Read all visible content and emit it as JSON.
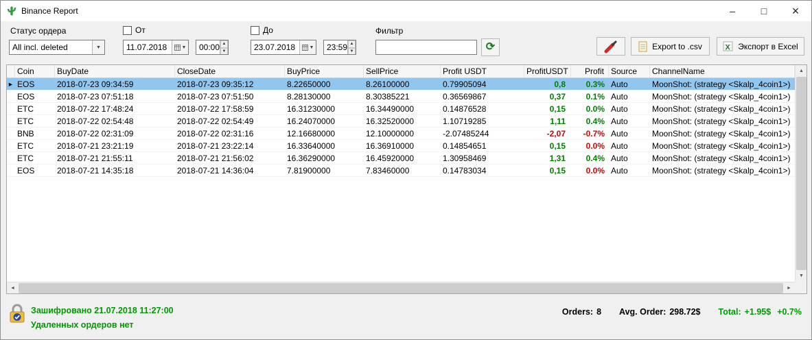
{
  "window": {
    "title": "Binance Report"
  },
  "icons": {
    "minimize": "–",
    "maximize": "□",
    "close": "×",
    "down_arrow": "▼",
    "up_arrow": "▲",
    "left_arrow": "◄",
    "right_arrow": "►",
    "row_pointer": "►",
    "refresh": "⟳"
  },
  "colors": {
    "selection": "#93c6ef",
    "positive": "#007e00",
    "negative": "#d40000",
    "status_green": "#009900"
  },
  "toolbar": {
    "status_label": "Статус ордера",
    "status_value": "All incl. deleted",
    "from_label": "От",
    "from_date": "11.07.2018",
    "from_time": "00:00",
    "to_label": "До",
    "to_date": "23.07.2018",
    "to_time": "23:59",
    "filter_label": "Фильтр",
    "filter_value": "",
    "export_csv_label": "Export to .csv",
    "export_excel_label": "Экспорт в Excel"
  },
  "grid": {
    "columns": [
      {
        "key": "coin",
        "label": "Coin"
      },
      {
        "key": "buydate",
        "label": "BuyDate"
      },
      {
        "key": "closedate",
        "label": "CloseDate"
      },
      {
        "key": "buyprice",
        "label": "BuyPrice"
      },
      {
        "key": "sellprice",
        "label": "SellPrice"
      },
      {
        "key": "profitusdtfull",
        "label": "Profit USDT"
      },
      {
        "key": "profitusdt",
        "label": "ProfitUSDT"
      },
      {
        "key": "profitpct",
        "label": "Profit"
      },
      {
        "key": "source",
        "label": "Source"
      },
      {
        "key": "channel",
        "label": "ChannelName"
      }
    ],
    "rows": [
      {
        "coin": "EOS",
        "buydate": "2018-07-23 09:34:59",
        "closedate": "2018-07-23 09:35:12",
        "buyprice": "8.22650000",
        "sellprice": "8.26100000",
        "profitusdtfull": "0.79905094",
        "profitusdt": "0,8",
        "profitpct": "0.3%",
        "source": "Auto",
        "channel": "MoonShot: (strategy <Skalp_4coin1>)",
        "usdt_color": "pos",
        "pct_color": "pos",
        "selected": true
      },
      {
        "coin": "EOS",
        "buydate": "2018-07-23 07:51:18",
        "closedate": "2018-07-23 07:51:50",
        "buyprice": "8.28130000",
        "sellprice": "8.30385221",
        "profitusdtfull": "0.36569867",
        "profitusdt": "0,37",
        "profitpct": "0.1%",
        "source": "Auto",
        "channel": "MoonShot: (strategy <Skalp_4coin1>)",
        "usdt_color": "pos",
        "pct_color": "pos",
        "selected": false
      },
      {
        "coin": "ETC",
        "buydate": "2018-07-22 17:48:24",
        "closedate": "2018-07-22 17:58:59",
        "buyprice": "16.31230000",
        "sellprice": "16.34490000",
        "profitusdtfull": "0.14876528",
        "profitusdt": "0,15",
        "profitpct": "0.0%",
        "source": "Auto",
        "channel": "MoonShot: (strategy <Skalp_4coin1>)",
        "usdt_color": "pos",
        "pct_color": "pos",
        "selected": false
      },
      {
        "coin": "ETC",
        "buydate": "2018-07-22 02:54:48",
        "closedate": "2018-07-22 02:54:49",
        "buyprice": "16.24070000",
        "sellprice": "16.32520000",
        "profitusdtfull": "1.10719285",
        "profitusdt": "1,11",
        "profitpct": "0.4%",
        "source": "Auto",
        "channel": "MoonShot: (strategy <Skalp_4coin1>)",
        "usdt_color": "pos",
        "pct_color": "pos",
        "selected": false
      },
      {
        "coin": "BNB",
        "buydate": "2018-07-22 02:31:09",
        "closedate": "2018-07-22 02:31:16",
        "buyprice": "12.16680000",
        "sellprice": "12.10000000",
        "profitusdtfull": "-2.07485244",
        "profitusdt": "-2,07",
        "profitpct": "-0.7%",
        "source": "Auto",
        "channel": "MoonShot: (strategy <Skalp_4coin1>)",
        "usdt_color": "neg",
        "pct_color": "neg",
        "selected": false
      },
      {
        "coin": "ETC",
        "buydate": "2018-07-21 23:21:19",
        "closedate": "2018-07-21 23:22:14",
        "buyprice": "16.33640000",
        "sellprice": "16.36910000",
        "profitusdtfull": "0.14854651",
        "profitusdt": "0,15",
        "profitpct": "0.0%",
        "source": "Auto",
        "channel": "MoonShot: (strategy <Skalp_4coin1>)",
        "usdt_color": "pos",
        "pct_color": "neg",
        "selected": false
      },
      {
        "coin": "ETC",
        "buydate": "2018-07-21 21:55:11",
        "closedate": "2018-07-21 21:56:02",
        "buyprice": "16.36290000",
        "sellprice": "16.45920000",
        "profitusdtfull": "1.30958469",
        "profitusdt": "1,31",
        "profitpct": "0.4%",
        "source": "Auto",
        "channel": "MoonShot: (strategy <Skalp_4coin1>)",
        "usdt_color": "pos",
        "pct_color": "pos",
        "selected": false
      },
      {
        "coin": "EOS",
        "buydate": "2018-07-21 14:35:18",
        "closedate": "2018-07-21 14:36:04",
        "buyprice": "7.81900000",
        "sellprice": "7.83460000",
        "profitusdtfull": "0.14783034",
        "profitusdt": "0,15",
        "profitpct": "0.0%",
        "source": "Auto",
        "channel": "MoonShot: (strategy <Skalp_4coin1>)",
        "usdt_color": "pos",
        "pct_color": "neg",
        "selected": false
      }
    ]
  },
  "statusbar": {
    "encrypted": "Зашифровано 21.07.2018 11:27:00",
    "deleted_info": "Удаленных ордеров нет",
    "orders_label": "Orders:",
    "orders_value": "8",
    "avg_label": "Avg. Order:",
    "avg_value": "298.72$",
    "total_label": "Total:",
    "total_value": "+1.95$",
    "total_pct": "+0.7%"
  }
}
